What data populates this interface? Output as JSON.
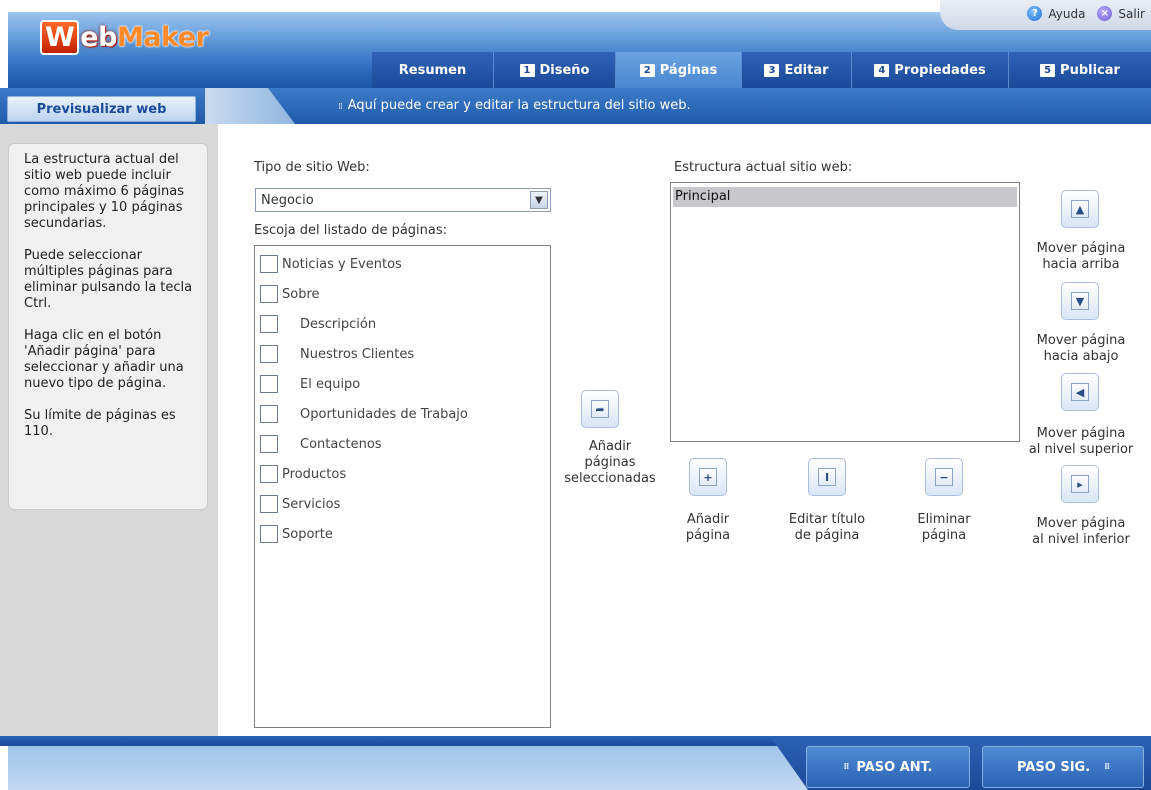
{
  "app": {
    "logo_first": "W",
    "logo_rest_1": "eb",
    "logo_rest_2": "Maker"
  },
  "header": {
    "help_label": "Ayuda",
    "exit_label": "Salir",
    "tabs": [
      {
        "num": "",
        "label": "Resumen"
      },
      {
        "num": "1",
        "label": "Diseño"
      },
      {
        "num": "2",
        "label": "Páginas",
        "active": true
      },
      {
        "num": "3",
        "label": "Editar"
      },
      {
        "num": "4",
        "label": "Propiedades"
      },
      {
        "num": "5",
        "label": "Publicar"
      }
    ]
  },
  "subbar": {
    "preview_button": "Previsualizar web",
    "hint": "Aquí puede crear y editar la estructura del sitio web."
  },
  "help_panel": {
    "p1": "La estructura actual del sitio web puede incluir como máximo 6 páginas principales y 10 páginas secundarias.",
    "p2": "Puede seleccionar múltiples páginas para eliminar pulsando la tecla Ctrl.",
    "p3": "Haga clic en el botón 'Añadir página' para seleccionar y añadir una nuevo tipo de página.",
    "p4": "Su límite de páginas es 110."
  },
  "main": {
    "site_type_label": "Tipo de sitio Web:",
    "site_type_value": "Negocio",
    "page_list_label": "Escoja del listado de páginas:",
    "pages": [
      {
        "label": "Noticias y Eventos",
        "sub": false
      },
      {
        "label": "Sobre",
        "sub": false
      },
      {
        "label": "Descripción",
        "sub": true
      },
      {
        "label": "Nuestros Clientes",
        "sub": true
      },
      {
        "label": "El equipo",
        "sub": true
      },
      {
        "label": "Oportunidades de Trabajo",
        "sub": true
      },
      {
        "label": "Contactenos",
        "sub": true
      },
      {
        "label": "Productos",
        "sub": false
      },
      {
        "label": "Servicios",
        "sub": false
      },
      {
        "label": "Soporte",
        "sub": false
      }
    ],
    "add_selected_label_1": "Añadir",
    "add_selected_label_2": "páginas",
    "add_selected_label_3": "seleccionadas",
    "structure_label": "Estructura actual sitio web:",
    "structure_items": [
      "Principal"
    ],
    "add_page_1": "Añadir",
    "add_page_2": "página",
    "edit_title_1": "Editar título",
    "edit_title_2": "de página",
    "delete_page_1": "Eliminar",
    "delete_page_2": "página",
    "move_up_1": "Mover página",
    "move_up_2": "hacia arriba",
    "move_down_1": "Mover página",
    "move_down_2": "hacia abajo",
    "move_top_1": "Mover página",
    "move_top_2": "al nivel superior",
    "move_bottom_1": "Mover página",
    "move_bottom_2": "al nivel inferior"
  },
  "footer": {
    "prev_label": "PASO ANT.",
    "next_label": "PASO SIG."
  }
}
